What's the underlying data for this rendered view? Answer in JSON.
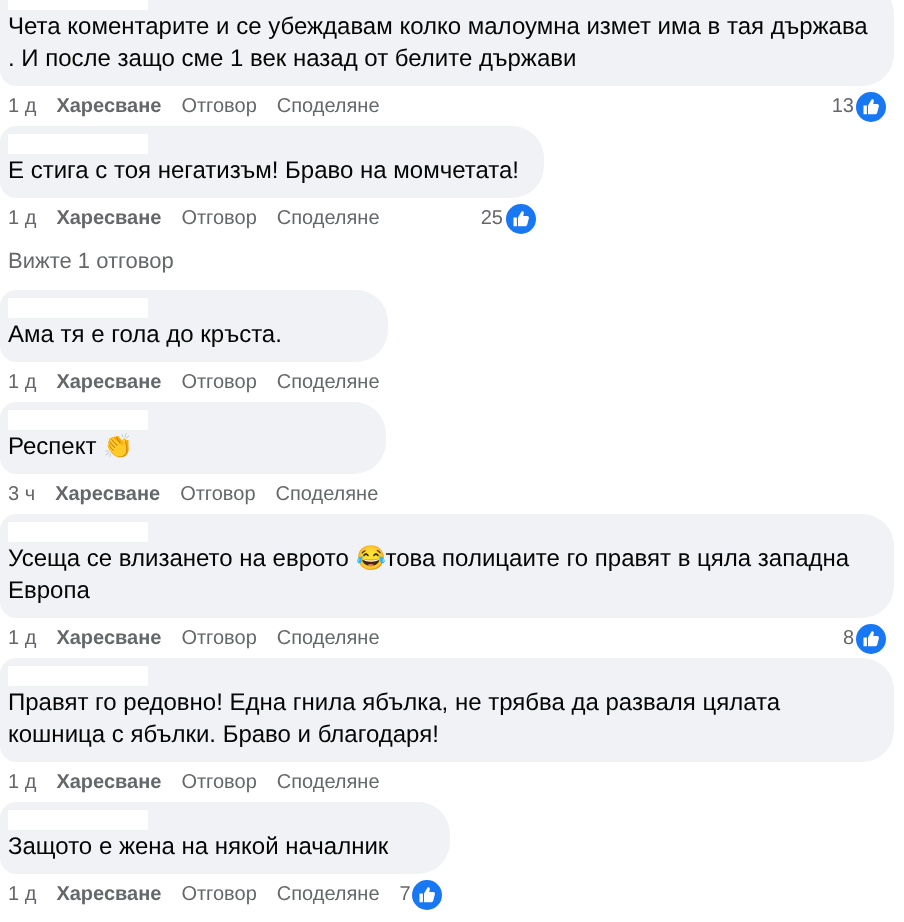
{
  "comments": [
    {
      "text": "Чета коментарите и се убеждавам колко малоумна измет има в тая държава . И после защо сме 1 век назад от белите държави",
      "time": "1 д",
      "actions": [
        "Харесване",
        "Отговор",
        "Споделяне"
      ],
      "likes": "13"
    },
    {
      "text": "Е стига с тоя негатизъм! Браво на момчетата!",
      "time": "1 д",
      "actions": [
        "Харесване",
        "Отговор",
        "Споделяне"
      ],
      "likes": "25",
      "view_replies": "Вижте 1 отговор"
    },
    {
      "text": "Ама тя е гола до кръста.",
      "time": "1 д",
      "actions": [
        "Харесване",
        "Отговор",
        "Споделяне"
      ]
    },
    {
      "text": "Респект 👏",
      "time": "3 ч",
      "actions": [
        "Харесване",
        "Отговор",
        "Споделяне"
      ]
    },
    {
      "text": "Усеща се влизането на еврото 😂това полицаите го правят в цяла западна Европа",
      "time": "1 д",
      "actions": [
        "Харесване",
        "Отговор",
        "Споделяне"
      ],
      "likes": "8"
    },
    {
      "text": "Правят го редовно! Една гнила ябълка, не трябва да разваля цялата кошница с ябълки. Браво и благодаря!",
      "time": "1 д",
      "actions": [
        "Харесване",
        "Отговор",
        "Споделяне"
      ]
    },
    {
      "text": "Защото е жена на някой началник",
      "time": "1 д",
      "actions": [
        "Харесване",
        "Отговор",
        "Споделяне"
      ],
      "likes": "7"
    }
  ]
}
